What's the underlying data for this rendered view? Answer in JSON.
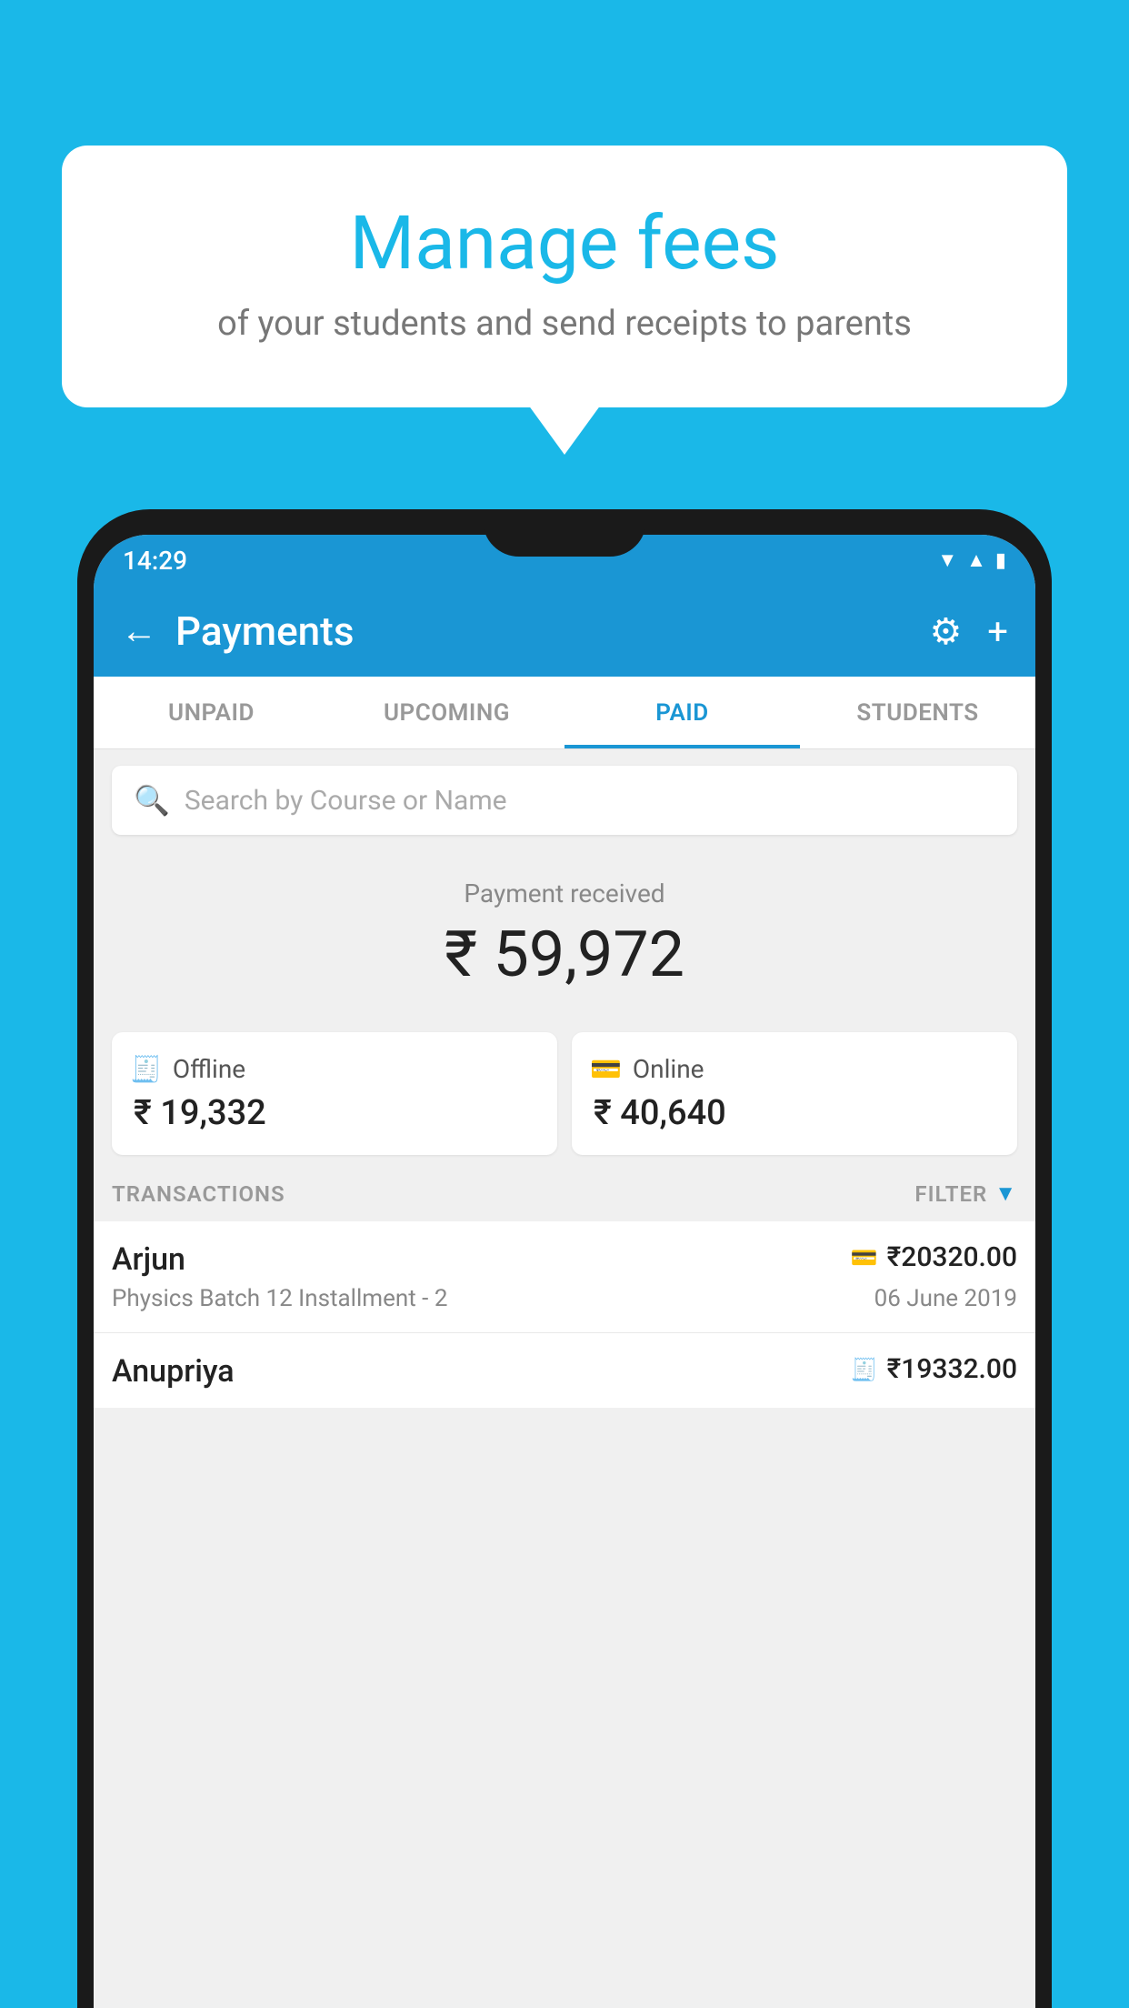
{
  "background_color": "#1ab8e8",
  "speech_bubble": {
    "title": "Manage fees",
    "subtitle": "of your students and send receipts to parents"
  },
  "phone": {
    "status_bar": {
      "time": "14:29",
      "icons": [
        "wifi",
        "signal",
        "battery"
      ]
    },
    "app_bar": {
      "title": "Payments",
      "back_label": "←",
      "gear_label": "⚙",
      "plus_label": "+"
    },
    "tabs": [
      {
        "label": "UNPAID",
        "active": false
      },
      {
        "label": "UPCOMING",
        "active": false
      },
      {
        "label": "PAID",
        "active": true
      },
      {
        "label": "STUDENTS",
        "active": false
      }
    ],
    "search": {
      "placeholder": "Search by Course or Name"
    },
    "payment_received": {
      "label": "Payment received",
      "amount": "₹ 59,972"
    },
    "payment_cards": [
      {
        "type": "Offline",
        "icon": "🧾",
        "amount": "₹ 19,332"
      },
      {
        "type": "Online",
        "icon": "💳",
        "amount": "₹ 40,640"
      }
    ],
    "transactions_section": {
      "label": "TRANSACTIONS",
      "filter_label": "FILTER"
    },
    "transactions": [
      {
        "name": "Arjun",
        "amount": "₹20320.00",
        "type_icon": "💳",
        "course": "Physics Batch 12 Installment - 2",
        "date": "06 June 2019"
      },
      {
        "name": "Anupriya",
        "amount": "₹19332.00",
        "type_icon": "🧾",
        "course": "",
        "date": ""
      }
    ]
  }
}
